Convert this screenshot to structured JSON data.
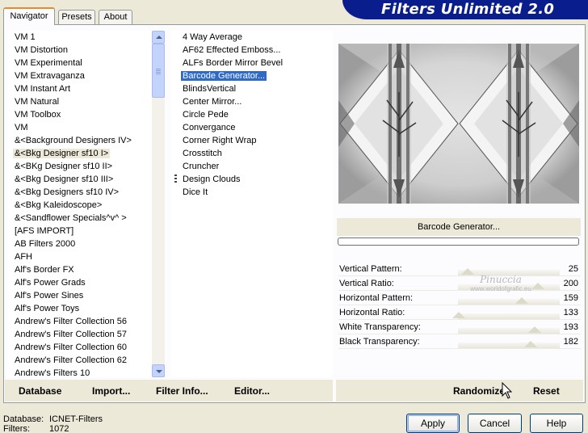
{
  "window": {
    "title": "Filters Unlimited 2.0"
  },
  "tabs": [
    {
      "label": "Navigator",
      "active": true
    },
    {
      "label": "Presets",
      "active": false
    },
    {
      "label": "About",
      "active": false
    }
  ],
  "categories": [
    {
      "label": "VM 1"
    },
    {
      "label": "VM Distortion"
    },
    {
      "label": "VM Experimental"
    },
    {
      "label": "VM Extravaganza"
    },
    {
      "label": "VM Instant Art"
    },
    {
      "label": "VM Natural"
    },
    {
      "label": "VM Toolbox"
    },
    {
      "label": "VM"
    },
    {
      "label": "&<Background Designers IV>"
    },
    {
      "label": "&<Bkg Designer sf10 I>",
      "highlighted": true
    },
    {
      "label": "&<BKg Designer sf10 II>"
    },
    {
      "label": "&<Bkg Designer sf10 III>"
    },
    {
      "label": "&<Bkg Designers sf10 IV>"
    },
    {
      "label": "&<Bkg Kaleidoscope>"
    },
    {
      "label": "&<Sandflower Specials^v^ >"
    },
    {
      "label": "[AFS IMPORT]"
    },
    {
      "label": "AB Filters 2000"
    },
    {
      "label": "AFH"
    },
    {
      "label": "Alf's Border FX"
    },
    {
      "label": "Alf's Power Grads"
    },
    {
      "label": "Alf's Power Sines"
    },
    {
      "label": "Alf's Power Toys"
    },
    {
      "label": "Andrew's Filter Collection 56"
    },
    {
      "label": "Andrew's Filter Collection 57"
    },
    {
      "label": "Andrew's Filter Collection 60"
    },
    {
      "label": "Andrew's Filter Collection 62"
    },
    {
      "label": "Andrew's Filters 10"
    }
  ],
  "filters": [
    {
      "label": "4 Way Average"
    },
    {
      "label": "AF62 Effected Emboss..."
    },
    {
      "label": "ALFs Border Mirror Bevel"
    },
    {
      "label": "Barcode Generator...",
      "selected": true
    },
    {
      "label": "BlindsVertical"
    },
    {
      "label": "Center Mirror..."
    },
    {
      "label": "Circle Pede"
    },
    {
      "label": "Convergance"
    },
    {
      "label": "Corner Right Wrap"
    },
    {
      "label": "Crosstitch"
    },
    {
      "label": "Cruncher"
    },
    {
      "label": "Design Clouds"
    },
    {
      "label": "Dice It"
    }
  ],
  "preview": {
    "filter_name": "Barcode Generator..."
  },
  "parameters": [
    {
      "label": "Vertical Pattern:",
      "value": "25",
      "slider": 0.098
    },
    {
      "label": "Vertical Ratio:",
      "value": "200",
      "slider": 0.784
    },
    {
      "label": "Horizontal Pattern:",
      "value": "159",
      "slider": 0.624
    },
    {
      "label": "Horizontal Ratio:",
      "value": "133",
      "slider": 0.004
    },
    {
      "label": "White Transparency:",
      "value": "193",
      "slider": 0.757
    },
    {
      "label": "Black Transparency:",
      "value": "182",
      "slider": 0.714
    }
  ],
  "watermark": {
    "line1": "Pinuccia",
    "line2": "www.worldofgrafic.eu"
  },
  "left_toolbar": {
    "database": "Database",
    "import": "Import...",
    "filter_info": "Filter Info...",
    "editor": "Editor..."
  },
  "right_toolbar": {
    "randomize": "Randomize",
    "reset": "Reset"
  },
  "status": {
    "database_label": "Database:",
    "database_value": "ICNET-Filters",
    "filters_label": "Filters:",
    "filters_value": "1072"
  },
  "buttons": {
    "apply": "Apply",
    "cancel": "Cancel",
    "help": "Help"
  },
  "colors": {
    "banner": "#0a1d8c",
    "selection": "#316ac5",
    "tab_accent": "#e68b2c"
  }
}
